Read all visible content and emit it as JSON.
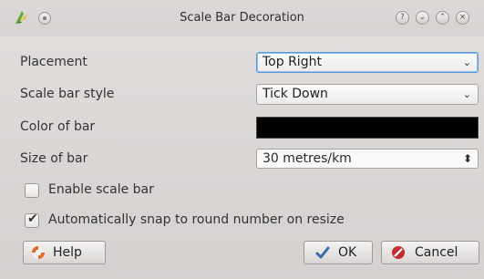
{
  "window": {
    "title": "Scale Bar Decoration"
  },
  "titlebar": {
    "help_glyph": "?",
    "minimize_glyph": "⌄",
    "maximize_glyph": "⌃",
    "close_glyph": "×"
  },
  "form": {
    "placement": {
      "label": "Placement",
      "value": "Top Right"
    },
    "style": {
      "label": "Scale bar style",
      "value": "Tick Down"
    },
    "color": {
      "label": "Color of bar",
      "value": "#000000"
    },
    "size": {
      "label": "Size of bar",
      "value": "30 metres/km"
    },
    "enable": {
      "label": "Enable scale bar",
      "checked": false
    },
    "snap": {
      "label": "Automatically snap to round number on resize",
      "checked": true
    }
  },
  "buttons": {
    "help": "Help",
    "ok": "OK",
    "cancel": "Cancel"
  },
  "icons": {
    "app": "qgis-logo-icon",
    "help": "lifebuoy-icon",
    "ok": "checkmark-icon",
    "cancel": "no-entry-icon"
  }
}
